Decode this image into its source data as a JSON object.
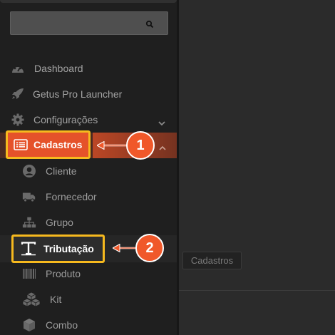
{
  "search": {
    "value": "",
    "placeholder": ""
  },
  "menu": {
    "dashboard": "Dashboard",
    "launcher": "Getus Pro Launcher",
    "configuracoes": "Configurações",
    "cadastros": "Cadastros"
  },
  "submenu": {
    "cliente": "Cliente",
    "fornecedor": "Fornecedor",
    "grupo": "Grupo",
    "tributacao": "Tributação",
    "produto": "Produto",
    "kit": "Kit",
    "combo": "Combo"
  },
  "callouts": {
    "first": "1",
    "second": "2"
  },
  "tooltip": {
    "text": "Cadastros"
  },
  "icons": {
    "dashboard": "gauge-icon",
    "launcher": "rocket-icon",
    "configuracoes": "gear-icon",
    "cadastros": "list-card-icon",
    "cliente": "user-circle-icon",
    "fornecedor": "truck-icon",
    "grupo": "sitemap-icon",
    "tributacao": "text-tool-icon",
    "produto": "barcode-icon",
    "kit": "cubes-icon",
    "combo": "cube-icon"
  },
  "colors": {
    "accent": "#e5522a",
    "highlight_border": "#f6b91e",
    "callout": "#f0582a",
    "sidebar": "#1f1f1f"
  }
}
